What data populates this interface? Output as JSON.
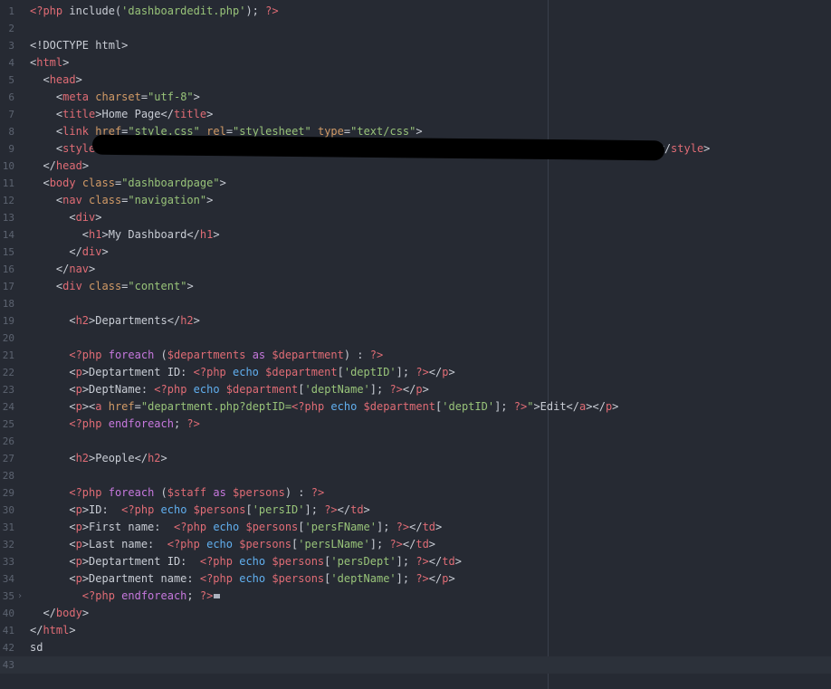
{
  "editor": {
    "background": "#262a33",
    "lines": [
      {
        "n": "1",
        "tokens": [
          [
            "php",
            "<?php "
          ],
          [
            "plain",
            "include("
          ],
          [
            "str",
            "'dashboardedit.php'"
          ],
          [
            "plain",
            "); "
          ],
          [
            "php",
            "?>"
          ]
        ]
      },
      {
        "n": "2",
        "tokens": []
      },
      {
        "n": "3",
        "tokens": [
          [
            "plain",
            "<!DOCTYPE html>"
          ]
        ]
      },
      {
        "n": "4",
        "tokens": [
          [
            "plain",
            "<"
          ],
          [
            "tag",
            "html"
          ],
          [
            "plain",
            ">"
          ]
        ]
      },
      {
        "n": "5",
        "tokens": [
          [
            "plain",
            "  <"
          ],
          [
            "tag",
            "head"
          ],
          [
            "plain",
            ">"
          ]
        ]
      },
      {
        "n": "6",
        "tokens": [
          [
            "plain",
            "    <"
          ],
          [
            "tag",
            "meta"
          ],
          [
            "plain",
            " "
          ],
          [
            "attr",
            "charset"
          ],
          [
            "plain",
            "="
          ],
          [
            "str",
            "\"utf-8\""
          ],
          [
            "plain",
            ">"
          ]
        ]
      },
      {
        "n": "7",
        "tokens": [
          [
            "plain",
            "    <"
          ],
          [
            "tag",
            "title"
          ],
          [
            "plain",
            ">Home Page</"
          ],
          [
            "tag",
            "title"
          ],
          [
            "plain",
            ">"
          ]
        ]
      },
      {
        "n": "8",
        "tokens": [
          [
            "plain",
            "    <"
          ],
          [
            "tag",
            "link"
          ],
          [
            "plain",
            " "
          ],
          [
            "attr",
            "href"
          ],
          [
            "plain",
            "="
          ],
          [
            "str",
            "\"style.css\""
          ],
          [
            "plain",
            " "
          ],
          [
            "attr",
            "rel"
          ],
          [
            "plain",
            "="
          ],
          [
            "str",
            "\"stylesheet\""
          ],
          [
            "plain",
            " "
          ],
          [
            "attr",
            "type"
          ],
          [
            "plain",
            "="
          ],
          [
            "str",
            "\"text/css\""
          ],
          [
            "plain",
            ">"
          ]
        ]
      },
      {
        "n": "9",
        "tokens": [
          [
            "plain",
            "    <"
          ],
          [
            "tag",
            "style"
          ],
          [
            "plain",
            "{"
          ],
          [
            "plain",
            "                                                                                  "
          ],
          [
            "str",
            "'"
          ],
          [
            "plain",
            ");</"
          ],
          [
            "tag",
            "style"
          ],
          [
            "plain",
            ">"
          ]
        ]
      },
      {
        "n": "10",
        "tokens": [
          [
            "plain",
            "  </"
          ],
          [
            "tag",
            "head"
          ],
          [
            "plain",
            ">"
          ]
        ]
      },
      {
        "n": "11",
        "tokens": [
          [
            "plain",
            "  <"
          ],
          [
            "tag",
            "body"
          ],
          [
            "plain",
            " "
          ],
          [
            "attr",
            "class"
          ],
          [
            "plain",
            "="
          ],
          [
            "str",
            "\"dashboardpage\""
          ],
          [
            "plain",
            ">"
          ]
        ]
      },
      {
        "n": "12",
        "tokens": [
          [
            "plain",
            "    <"
          ],
          [
            "tag",
            "nav"
          ],
          [
            "plain",
            " "
          ],
          [
            "attr",
            "class"
          ],
          [
            "plain",
            "="
          ],
          [
            "str",
            "\"navigation\""
          ],
          [
            "plain",
            ">"
          ]
        ]
      },
      {
        "n": "13",
        "tokens": [
          [
            "plain",
            "      <"
          ],
          [
            "tag",
            "div"
          ],
          [
            "plain",
            ">"
          ]
        ]
      },
      {
        "n": "14",
        "tokens": [
          [
            "plain",
            "        <"
          ],
          [
            "tag",
            "h1"
          ],
          [
            "plain",
            ">My Dashboard</"
          ],
          [
            "tag",
            "h1"
          ],
          [
            "plain",
            ">"
          ]
        ]
      },
      {
        "n": "15",
        "tokens": [
          [
            "plain",
            "      </"
          ],
          [
            "tag",
            "div"
          ],
          [
            "plain",
            ">"
          ]
        ]
      },
      {
        "n": "16",
        "tokens": [
          [
            "plain",
            "    </"
          ],
          [
            "tag",
            "nav"
          ],
          [
            "plain",
            ">"
          ]
        ]
      },
      {
        "n": "17",
        "tokens": [
          [
            "plain",
            "    <"
          ],
          [
            "tag",
            "div"
          ],
          [
            "plain",
            " "
          ],
          [
            "attr",
            "class"
          ],
          [
            "plain",
            "="
          ],
          [
            "str",
            "\"content\""
          ],
          [
            "plain",
            ">"
          ]
        ]
      },
      {
        "n": "18",
        "tokens": []
      },
      {
        "n": "19",
        "tokens": [
          [
            "plain",
            "      <"
          ],
          [
            "tag",
            "h2"
          ],
          [
            "plain",
            ">Departments</"
          ],
          [
            "tag",
            "h2"
          ],
          [
            "plain",
            ">"
          ]
        ]
      },
      {
        "n": "20",
        "tokens": []
      },
      {
        "n": "21",
        "tokens": [
          [
            "plain",
            "      "
          ],
          [
            "php",
            "<?php "
          ],
          [
            "kw",
            "foreach"
          ],
          [
            "plain",
            " ("
          ],
          [
            "var",
            "$departments"
          ],
          [
            "plain",
            " "
          ],
          [
            "kw",
            "as"
          ],
          [
            "plain",
            " "
          ],
          [
            "var",
            "$department"
          ],
          [
            "plain",
            ") : "
          ],
          [
            "php",
            "?>"
          ]
        ]
      },
      {
        "n": "22",
        "tokens": [
          [
            "plain",
            "      <"
          ],
          [
            "tag",
            "p"
          ],
          [
            "plain",
            ">Deptartment ID: "
          ],
          [
            "php",
            "<?php "
          ],
          [
            "fn",
            "echo"
          ],
          [
            "plain",
            " "
          ],
          [
            "var",
            "$department"
          ],
          [
            "plain",
            "["
          ],
          [
            "str",
            "'deptID'"
          ],
          [
            "plain",
            "]; "
          ],
          [
            "php",
            "?>"
          ],
          [
            "plain",
            "</"
          ],
          [
            "tag",
            "p"
          ],
          [
            "plain",
            ">"
          ]
        ]
      },
      {
        "n": "23",
        "tokens": [
          [
            "plain",
            "      <"
          ],
          [
            "tag",
            "p"
          ],
          [
            "plain",
            ">DeptName: "
          ],
          [
            "php",
            "<?php "
          ],
          [
            "fn",
            "echo"
          ],
          [
            "plain",
            " "
          ],
          [
            "var",
            "$department"
          ],
          [
            "plain",
            "["
          ],
          [
            "str",
            "'deptName'"
          ],
          [
            "plain",
            "]; "
          ],
          [
            "php",
            "?>"
          ],
          [
            "plain",
            "</"
          ],
          [
            "tag",
            "p"
          ],
          [
            "plain",
            ">"
          ]
        ]
      },
      {
        "n": "24",
        "tokens": [
          [
            "plain",
            "      <"
          ],
          [
            "tag",
            "p"
          ],
          [
            "plain",
            "><"
          ],
          [
            "tag",
            "a"
          ],
          [
            "plain",
            " "
          ],
          [
            "attr",
            "href"
          ],
          [
            "plain",
            "="
          ],
          [
            "str",
            "\"department.php?deptID="
          ],
          [
            "php",
            "<?php "
          ],
          [
            "fn",
            "echo"
          ],
          [
            "plain",
            " "
          ],
          [
            "var",
            "$department"
          ],
          [
            "plain",
            "["
          ],
          [
            "str",
            "'deptID'"
          ],
          [
            "plain",
            "]; "
          ],
          [
            "php",
            "?>"
          ],
          [
            "str",
            "\""
          ],
          [
            "plain",
            ">Edit</"
          ],
          [
            "tag",
            "a"
          ],
          [
            "plain",
            "></"
          ],
          [
            "tag",
            "p"
          ],
          [
            "plain",
            ">"
          ]
        ]
      },
      {
        "n": "25",
        "tokens": [
          [
            "plain",
            "      "
          ],
          [
            "php",
            "<?php "
          ],
          [
            "kw",
            "endforeach"
          ],
          [
            "plain",
            "; "
          ],
          [
            "php",
            "?>"
          ]
        ]
      },
      {
        "n": "26",
        "tokens": []
      },
      {
        "n": "27",
        "tokens": [
          [
            "plain",
            "      <"
          ],
          [
            "tag",
            "h2"
          ],
          [
            "plain",
            ">People</"
          ],
          [
            "tag",
            "h2"
          ],
          [
            "plain",
            ">"
          ]
        ]
      },
      {
        "n": "28",
        "tokens": []
      },
      {
        "n": "29",
        "tokens": [
          [
            "plain",
            "      "
          ],
          [
            "php",
            "<?php "
          ],
          [
            "kw",
            "foreach"
          ],
          [
            "plain",
            " ("
          ],
          [
            "var",
            "$staff"
          ],
          [
            "plain",
            " "
          ],
          [
            "kw",
            "as"
          ],
          [
            "plain",
            " "
          ],
          [
            "var",
            "$persons"
          ],
          [
            "plain",
            ") : "
          ],
          [
            "php",
            "?>"
          ]
        ]
      },
      {
        "n": "30",
        "tokens": [
          [
            "plain",
            "      <"
          ],
          [
            "tag",
            "p"
          ],
          [
            "plain",
            ">ID:  "
          ],
          [
            "php",
            "<?php "
          ],
          [
            "fn",
            "echo"
          ],
          [
            "plain",
            " "
          ],
          [
            "var",
            "$persons"
          ],
          [
            "plain",
            "["
          ],
          [
            "str",
            "'persID'"
          ],
          [
            "plain",
            "]; "
          ],
          [
            "php",
            "?>"
          ],
          [
            "plain",
            "</"
          ],
          [
            "tag",
            "td"
          ],
          [
            "plain",
            ">"
          ]
        ]
      },
      {
        "n": "31",
        "tokens": [
          [
            "plain",
            "      <"
          ],
          [
            "tag",
            "p"
          ],
          [
            "plain",
            ">First name:  "
          ],
          [
            "php",
            "<?php "
          ],
          [
            "fn",
            "echo"
          ],
          [
            "plain",
            " "
          ],
          [
            "var",
            "$persons"
          ],
          [
            "plain",
            "["
          ],
          [
            "str",
            "'persFName'"
          ],
          [
            "plain",
            "]; "
          ],
          [
            "php",
            "?>"
          ],
          [
            "plain",
            "</"
          ],
          [
            "tag",
            "td"
          ],
          [
            "plain",
            ">"
          ]
        ]
      },
      {
        "n": "32",
        "tokens": [
          [
            "plain",
            "      <"
          ],
          [
            "tag",
            "p"
          ],
          [
            "plain",
            ">Last name:  "
          ],
          [
            "php",
            "<?php "
          ],
          [
            "fn",
            "echo"
          ],
          [
            "plain",
            " "
          ],
          [
            "var",
            "$persons"
          ],
          [
            "plain",
            "["
          ],
          [
            "str",
            "'persLName'"
          ],
          [
            "plain",
            "]; "
          ],
          [
            "php",
            "?>"
          ],
          [
            "plain",
            "</"
          ],
          [
            "tag",
            "td"
          ],
          [
            "plain",
            ">"
          ]
        ]
      },
      {
        "n": "33",
        "tokens": [
          [
            "plain",
            "      <"
          ],
          [
            "tag",
            "p"
          ],
          [
            "plain",
            ">Deptartment ID:  "
          ],
          [
            "php",
            "<?php "
          ],
          [
            "fn",
            "echo"
          ],
          [
            "plain",
            " "
          ],
          [
            "var",
            "$persons"
          ],
          [
            "plain",
            "["
          ],
          [
            "str",
            "'persDept'"
          ],
          [
            "plain",
            "]; "
          ],
          [
            "php",
            "?>"
          ],
          [
            "plain",
            "</"
          ],
          [
            "tag",
            "td"
          ],
          [
            "plain",
            ">"
          ]
        ]
      },
      {
        "n": "34",
        "tokens": [
          [
            "plain",
            "      <"
          ],
          [
            "tag",
            "p"
          ],
          [
            "plain",
            ">Department name: "
          ],
          [
            "php",
            "<?php "
          ],
          [
            "fn",
            "echo"
          ],
          [
            "plain",
            " "
          ],
          [
            "var",
            "$persons"
          ],
          [
            "plain",
            "["
          ],
          [
            "str",
            "'deptName'"
          ],
          [
            "plain",
            "]; "
          ],
          [
            "php",
            "?>"
          ],
          [
            "plain",
            "</"
          ],
          [
            "tag",
            "p"
          ],
          [
            "plain",
            ">"
          ]
        ]
      },
      {
        "n": "35",
        "fold": true,
        "tokens": [
          [
            "plain",
            "        "
          ],
          [
            "php",
            "<?php "
          ],
          [
            "kw",
            "endforeach"
          ],
          [
            "plain",
            "; "
          ],
          [
            "php",
            "?>"
          ]
        ]
      },
      {
        "n": "40",
        "tokens": [
          [
            "plain",
            "  </"
          ],
          [
            "tag",
            "body"
          ],
          [
            "plain",
            ">"
          ]
        ]
      },
      {
        "n": "41",
        "tokens": [
          [
            "plain",
            "</"
          ],
          [
            "tag",
            "html"
          ],
          [
            "plain",
            ">"
          ]
        ]
      },
      {
        "n": "42",
        "tokens": [
          [
            "plain",
            "sd"
          ]
        ]
      },
      {
        "n": "43",
        "current": true,
        "tokens": []
      }
    ]
  }
}
